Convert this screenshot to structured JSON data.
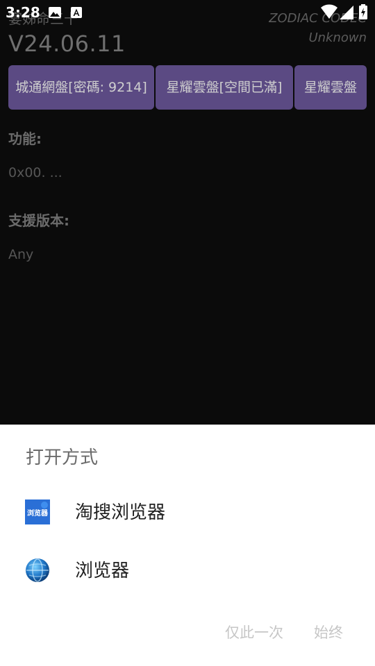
{
  "status_bar": {
    "time": "3:28",
    "icons": [
      "image-icon",
      "a-icon",
      "wifi-icon",
      "signal-icon",
      "battery-charging-icon"
    ]
  },
  "app": {
    "title": "宴姊命三十",
    "version": "V24.06.11",
    "codec_label": "ZODIAC CODEC",
    "status": "Unknown",
    "buttons": [
      {
        "label": "城通網盤[密碼: 9214]"
      },
      {
        "label": "星耀雲盤[空間已滿]"
      },
      {
        "label": "星耀雲盤"
      }
    ],
    "features_label": "功能:",
    "features_value": "0x00. ...",
    "support_label": "支援版本:",
    "support_value": "Any",
    "accent_color": "#5b4a83"
  },
  "sheet": {
    "title": "打开方式",
    "options": [
      {
        "label": "淘搜浏览器",
        "icon": "taosou-browser-icon",
        "icon_text": "浏览器"
      },
      {
        "label": "浏览器",
        "icon": "globe-browser-icon"
      }
    ],
    "actions": {
      "once": "仅此一次",
      "always": "始终"
    }
  }
}
